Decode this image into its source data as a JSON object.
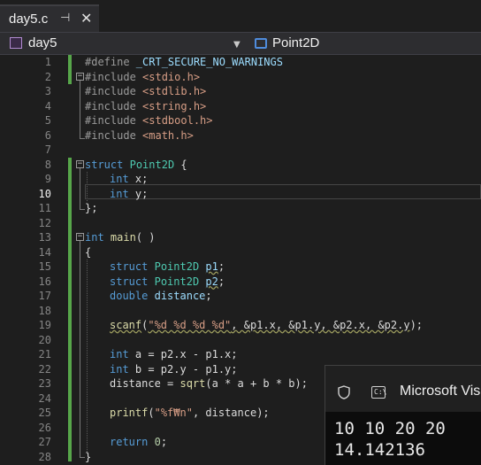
{
  "tab": {
    "title": "day5.c",
    "pin_glyph": "⊣",
    "close_glyph": "✕"
  },
  "navigation": {
    "file_scope": "day5",
    "member_scope": "Point2D"
  },
  "editor": {
    "current_line": 10,
    "lines": [
      {
        "num": "1"
      },
      {
        "num": "2"
      },
      {
        "num": "3"
      },
      {
        "num": "4"
      },
      {
        "num": "5"
      },
      {
        "num": "6"
      },
      {
        "num": "7"
      },
      {
        "num": "8"
      },
      {
        "num": "9"
      },
      {
        "num": "10"
      },
      {
        "num": "11"
      },
      {
        "num": "12"
      },
      {
        "num": "13"
      },
      {
        "num": "14"
      },
      {
        "num": "15"
      },
      {
        "num": "16"
      },
      {
        "num": "17"
      },
      {
        "num": "18"
      },
      {
        "num": "19"
      },
      {
        "num": "20"
      },
      {
        "num": "21"
      },
      {
        "num": "22"
      },
      {
        "num": "23"
      },
      {
        "num": "24"
      },
      {
        "num": "25"
      },
      {
        "num": "26"
      },
      {
        "num": "27"
      },
      {
        "num": "28"
      }
    ],
    "code": {
      "l1": {
        "a": "#define ",
        "b": "_CRT_SECURE_NO_WARNINGS"
      },
      "l2": {
        "a": "#include ",
        "b": "<stdio.h>"
      },
      "l3": {
        "a": "#include ",
        "b": "<stdlib.h>"
      },
      "l4": {
        "a": "#include ",
        "b": "<string.h>"
      },
      "l5": {
        "a": "#include ",
        "b": "<stdbool.h>"
      },
      "l6": {
        "a": "#include ",
        "b": "<math.h>"
      },
      "l8": {
        "a": "struct",
        "b": "Point2D",
        "c": " {"
      },
      "l9": {
        "a": "int",
        "b": " x;"
      },
      "l10": {
        "a": "int",
        "b": " y;"
      },
      "l11": {
        "a": "};"
      },
      "l13": {
        "a": "int",
        "b": "main",
        "c": "( )"
      },
      "l14": {
        "a": "{"
      },
      "l15": {
        "a": "struct",
        "b": "Point2D",
        "c": "p1",
        "d": ";"
      },
      "l16": {
        "a": "struct",
        "b": "Point2D",
        "c": "p2",
        "d": ";"
      },
      "l17": {
        "a": "double",
        "b": "distance",
        "c": ";"
      },
      "l19": {
        "a": "scanf",
        "b": "(",
        "c": "\"%d %d %d %d\"",
        "d": ", &p1.x, &p1.y, &p2.x, &p2.y",
        "e": ");"
      },
      "l21": {
        "a": "int",
        "b": " a = p2.x - p1.x;"
      },
      "l22": {
        "a": "int",
        "b": " b = p2.y - p1.y;"
      },
      "l23": {
        "a": "distance = ",
        "b": "sqrt",
        "c": "(a * a + b * b);"
      },
      "l25": {
        "a": "printf",
        "b": "(",
        "c": "\"%f₩n\"",
        "d": ", distance);"
      },
      "l27": {
        "a": "return",
        "b": " ",
        "c": "0",
        "d": ";"
      },
      "l28": {
        "a": "}"
      }
    }
  },
  "console": {
    "title": "Microsoft Visu",
    "icon_text": "C:\\",
    "output": [
      "10 10 20 20",
      "14.142136"
    ]
  },
  "colors": {
    "keyword": "#569cd6",
    "type": "#4ec9b0",
    "function": "#dcdcaa",
    "string": "#d69d85",
    "number": "#b5cea8",
    "change_bar": "#57a64a"
  }
}
